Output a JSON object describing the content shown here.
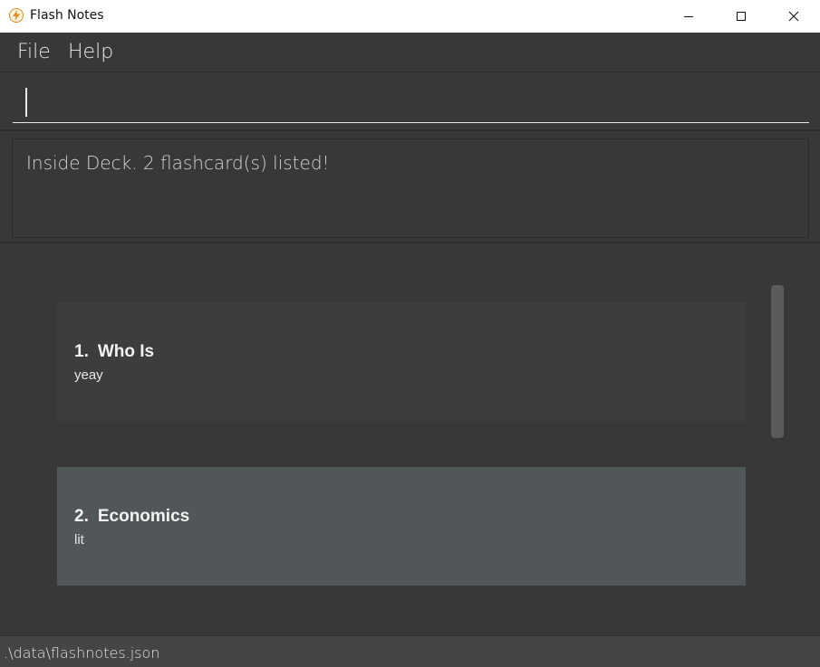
{
  "window": {
    "title": "Flash Notes",
    "icon": "lightning-icon",
    "controls": [
      "minimize-icon",
      "maximize-icon",
      "close-icon"
    ]
  },
  "menu": {
    "items": [
      "File",
      "Help"
    ]
  },
  "command": {
    "value": "",
    "placeholder": ""
  },
  "result": {
    "message": "Inside Deck. 2 flashcard(s) listed!"
  },
  "flashcards": [
    {
      "index": "1.",
      "title": "Who Is",
      "description": "yeay",
      "selected": false
    },
    {
      "index": "2.",
      "title": "Economics",
      "description": "lit",
      "selected": true
    }
  ],
  "status": {
    "file_path": ".\\data\\flashnotes.json"
  },
  "colors": {
    "background": "#383838",
    "card": "#3c3d3f",
    "card_selected": "#515658",
    "accent_icon": "#e08a1e"
  }
}
